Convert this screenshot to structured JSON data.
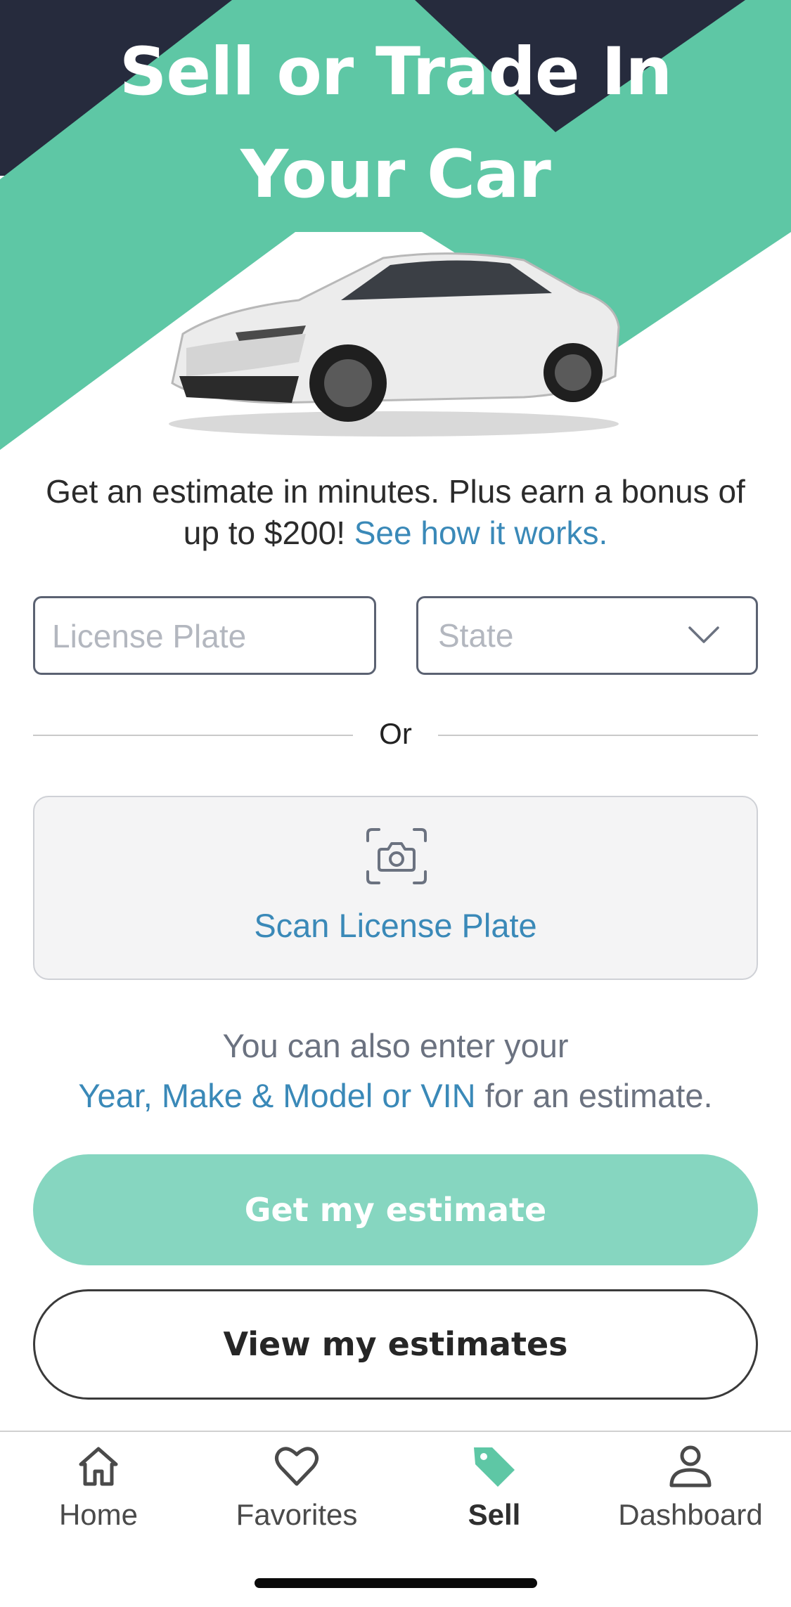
{
  "hero": {
    "title_line1": "Sell or Trade In",
    "title_line2": "Your Car"
  },
  "promo": {
    "text": "Get an estimate in minutes. Plus earn a bonus of up to $200!",
    "link": "See how it works."
  },
  "form": {
    "plate_placeholder": "License Plate",
    "state_placeholder": "State",
    "divider_text": "Or",
    "scan_label": "Scan License Plate"
  },
  "alt": {
    "line1": "You can also enter your",
    "link": "Year, Make & Model or VIN",
    "suffix": " for an estimate."
  },
  "buttons": {
    "primary": "Get my estimate",
    "secondary": "View my estimates"
  },
  "tabbar": {
    "items": [
      {
        "label": "Home",
        "icon": "home-icon"
      },
      {
        "label": "Favorites",
        "icon": "heart-icon"
      },
      {
        "label": "Sell",
        "icon": "tag-icon",
        "active": true
      },
      {
        "label": "Dashboard",
        "icon": "user-icon"
      }
    ]
  },
  "colors": {
    "teal": "#5ec7a5",
    "navy": "#262b3d",
    "link": "#3a89b8",
    "button": "#86d6c0"
  }
}
